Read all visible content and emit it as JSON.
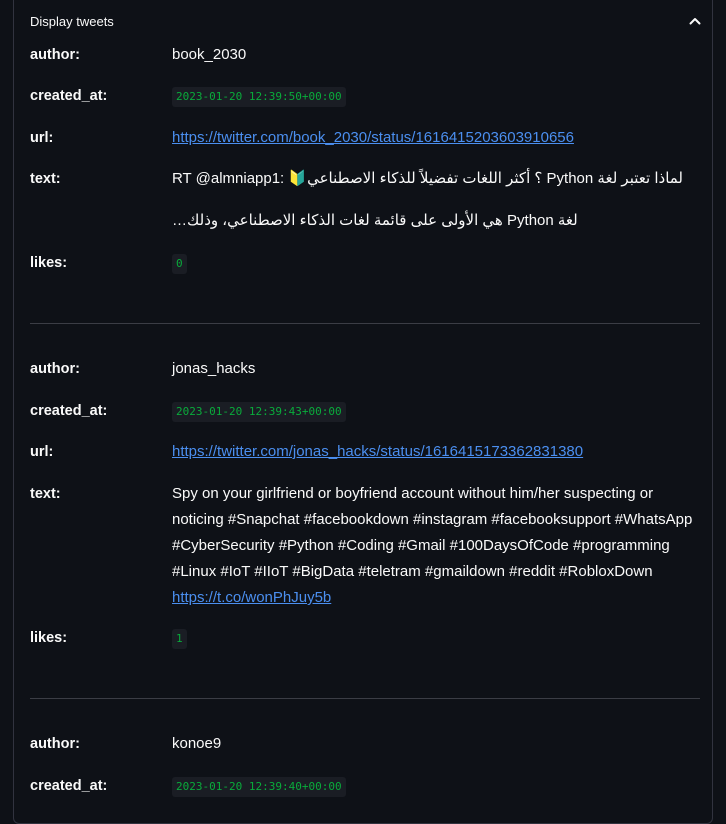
{
  "panel": {
    "title": "Display tweets"
  },
  "labels": {
    "author": "author:",
    "created_at": "created_at:",
    "url": "url:",
    "text": "text:",
    "likes": "likes:"
  },
  "tweets": [
    {
      "author": "book_2030",
      "created_at": "2023-01-20 12:39:50+00:00",
      "url": "https://twitter.com/book_2030/status/1616415203603910656",
      "text_line1_prefix": "RT @almniapp1: ",
      "text_line1_emoji": "🔰",
      "text_line1_rest": " لماذا تعتبر لغة Python ؟ أكثر اللغات تفضيلاً للذكاء الاصطناعي",
      "text_line2": "لغة Python هي الأولى على قائمة لغات الذكاء الاصطناعي، وذلك…",
      "likes": "0"
    },
    {
      "author": "jonas_hacks",
      "created_at": "2023-01-20 12:39:43+00:00",
      "url": "https://twitter.com/jonas_hacks/status/1616415173362831380",
      "text_lines": [
        "Spy on your girlfriend or boyfriend account without him/her suspecting or",
        "noticing #Snapchat #facebookdown #instagram #facebooksupport #WhatsApp",
        "#CyberSecurity #Python #Coding #Gmail #100DaysOfCode #programming",
        "#Linux #IoT #IIoT #BigData #teletram #gmaildown #reddit #RobloxDown"
      ],
      "text_link": "https://t.co/wonPhJuy5b",
      "likes": "1"
    },
    {
      "author": "konoe9",
      "created_at": "2023-01-20 12:39:40+00:00"
    }
  ]
}
